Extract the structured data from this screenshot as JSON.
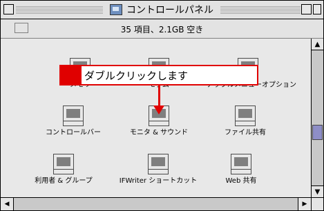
{
  "window": {
    "title": "コントロールパネル",
    "title_icon": "folder-icon",
    "info": "35 項目、2.1GB 空き"
  },
  "icons": [
    {
      "label": "メモリ",
      "icon": "memory-icon"
    },
    {
      "label": "モデム",
      "icon": "modem-icon"
    },
    {
      "label": "アップルメニューオプション",
      "icon": "apple-menu-options-icon"
    },
    {
      "label": "コントロールバー",
      "icon": "control-bar-icon"
    },
    {
      "label": "モニタ & サウンド",
      "icon": "monitors-sound-icon"
    },
    {
      "label": "ファイル共有",
      "icon": "file-sharing-icon"
    },
    {
      "label": "利用者 & グループ",
      "icon": "users-groups-icon"
    },
    {
      "label": "IFWriter ショートカット",
      "icon": "ifwriter-shortcut-icon"
    },
    {
      "label": "Web 共有",
      "icon": "web-sharing-icon"
    }
  ],
  "callout": {
    "text": "ダブルクリックします",
    "color": "#e00000"
  }
}
